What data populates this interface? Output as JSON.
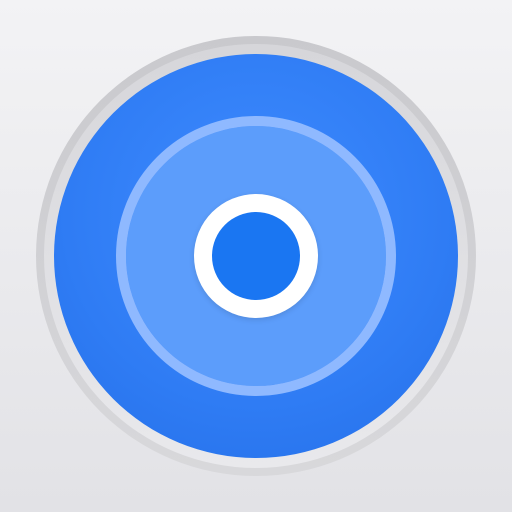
{
  "app_icon": {
    "icon_name": "location-beacon-icon",
    "colors": {
      "background_top": "#f3f3f5",
      "background_bottom": "#e2e2e6",
      "bezel": "#d0d0d4",
      "disc": "#2f7cf4",
      "pulse_ring": "#8fb9ff",
      "pulse_fill": "#5c9dfb",
      "center_ring": "#ffffff",
      "center_dot": "#1a76f2"
    }
  }
}
